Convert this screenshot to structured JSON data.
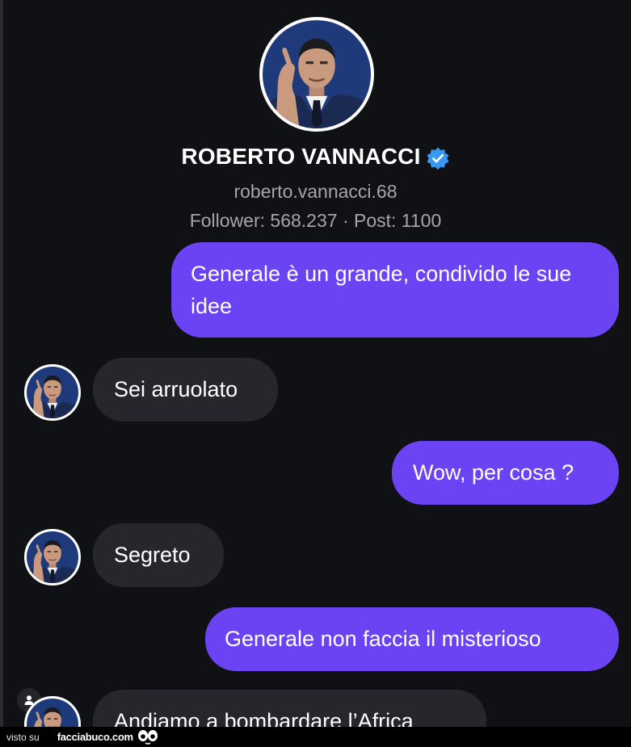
{
  "profile": {
    "name": "ROBERTO VANNACCI",
    "handle": "roberto.vannacci.68",
    "stats": "Follower: 568.237 · Post: 1100"
  },
  "messages": [
    {
      "side": "out",
      "text": "Generale è un grande, condivido le sue idee"
    },
    {
      "side": "in",
      "text": "Sei arruolato"
    },
    {
      "side": "out",
      "text": "Wow, per cosa ?"
    },
    {
      "side": "in",
      "text": "Segreto"
    },
    {
      "side": "out",
      "text": "Generale non faccia il misterioso"
    },
    {
      "side": "in",
      "text": "Andiamo a bombardare l’Africa"
    }
  ],
  "footer": {
    "prefix": "visto su",
    "brand": "facciabuco.com"
  },
  "colors": {
    "outgoing_bubble": "#6b43f2",
    "incoming_bubble": "#26272c",
    "background": "#101115",
    "verified_badge": "#3897f0"
  },
  "icons": {
    "verified": "verified-badge-icon",
    "person": "person-icon",
    "watermark": "eyes-icon"
  }
}
